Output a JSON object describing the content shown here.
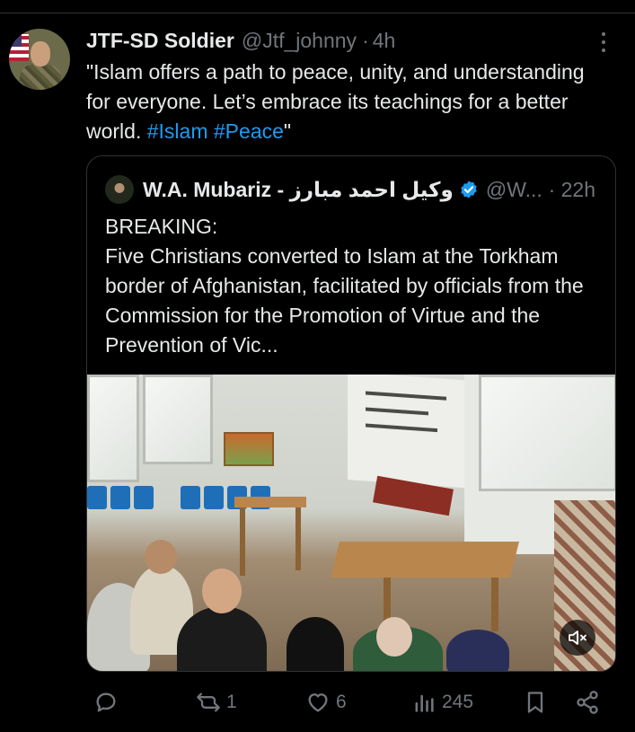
{
  "post": {
    "author_name": "JTF-SD Soldier",
    "author_handle": "@Jtf_johnny",
    "separator": "·",
    "time": "4h",
    "text_before": "\"Islam offers a path to peace, unity, and understanding for everyone. Let’s embrace its teachings for a better world. ",
    "hashtag_1": "#Islam",
    "hashtag_2": "#Peace",
    "text_after": "\""
  },
  "quote": {
    "author_name": "W.A. Mubariz - وکیل احمد مبارز",
    "author_handle": "@W...",
    "time": "· 22h",
    "text_line_1": "BREAKING:",
    "text_line_2": "Five Christians converted to Islam at the Torkham border of Afghanistan, facilitated by officials from the Commission for the Promotion of Virtue and the Prevention of Vic...",
    "verified_color": "#1d9bf0"
  },
  "actions": {
    "reply_icon": "reply-icon",
    "repost_count": "1",
    "like_count": "6",
    "views_count": "245",
    "bookmark_icon": "bookmark-icon",
    "share_icon": "share-icon"
  },
  "colors": {
    "background": "#000000",
    "text": "#e7e9ea",
    "muted": "#71767b",
    "link": "#1d9bf0",
    "border": "#2f3336"
  }
}
